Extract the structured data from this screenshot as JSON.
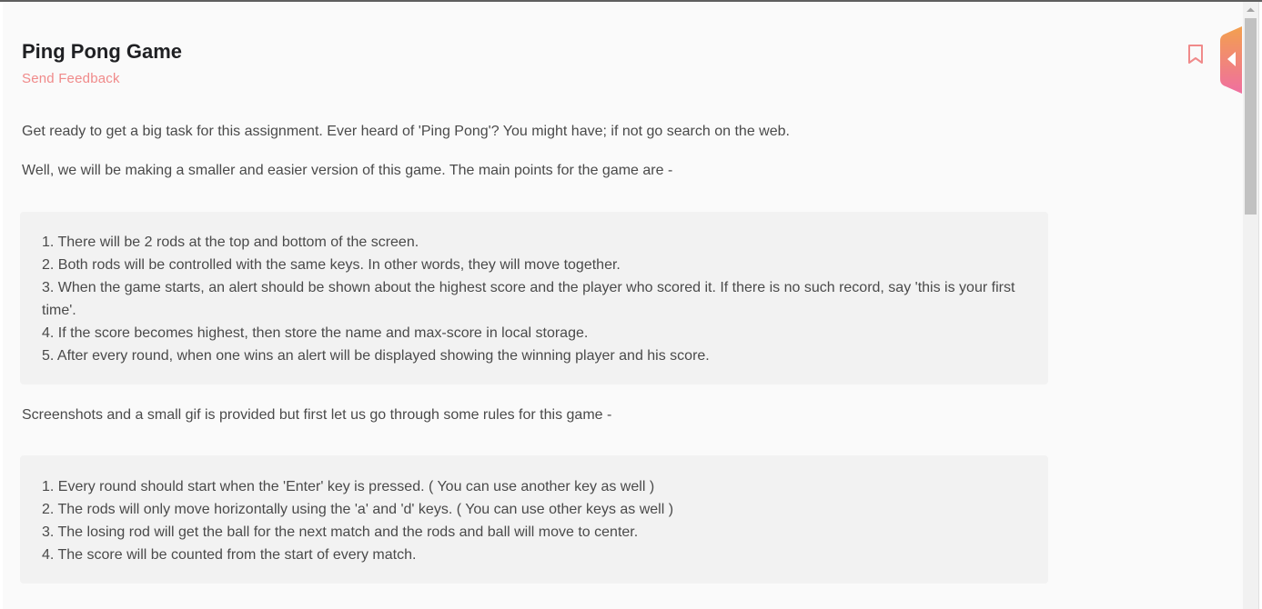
{
  "header": {
    "title": "Ping Pong Game",
    "feedback_link": "Send Feedback"
  },
  "intro": {
    "p1": "Get ready to get a big task for this assignment. Ever heard of 'Ping Pong'? You might have; if not go search on the web.",
    "p2": "Well, we will be making a smaller and easier version of this game. The main points for the game are -"
  },
  "main_points": [
    "1. There will be 2 rods at the top and bottom of the screen.",
    "2. Both rods will be controlled with the same keys. In other words, they will move together.",
    "3. When the game starts, an alert should be shown about the highest score and the player who scored it. If there is no such record, say 'this is your first time'.",
    "4. If the score becomes highest, then store the name and max-score in local storage.",
    "5. After every round, when one wins an alert will be displayed showing the winning player and his score."
  ],
  "rules_intro": "Screenshots and a small gif is provided but first let us go through some rules for this game -",
  "rules": [
    "1. Every round should start when the 'Enter' key is pressed. ( You can use another key as well )",
    "2. The rods will only move horizontally using the 'a' and 'd' keys. ( You can use other keys as well )",
    "3. The losing rod will get the ball for the next match and the rods and ball will move to center.",
    "4. The score will be counted from the start of every match."
  ],
  "icons": {
    "bookmark": "bookmark-icon",
    "side_tab": "side-panel-toggle-icon"
  },
  "colors": {
    "accent": "#f08a8a",
    "tab_gradient_top": "#f3a04e",
    "tab_gradient_bottom": "#ef6fa0"
  }
}
